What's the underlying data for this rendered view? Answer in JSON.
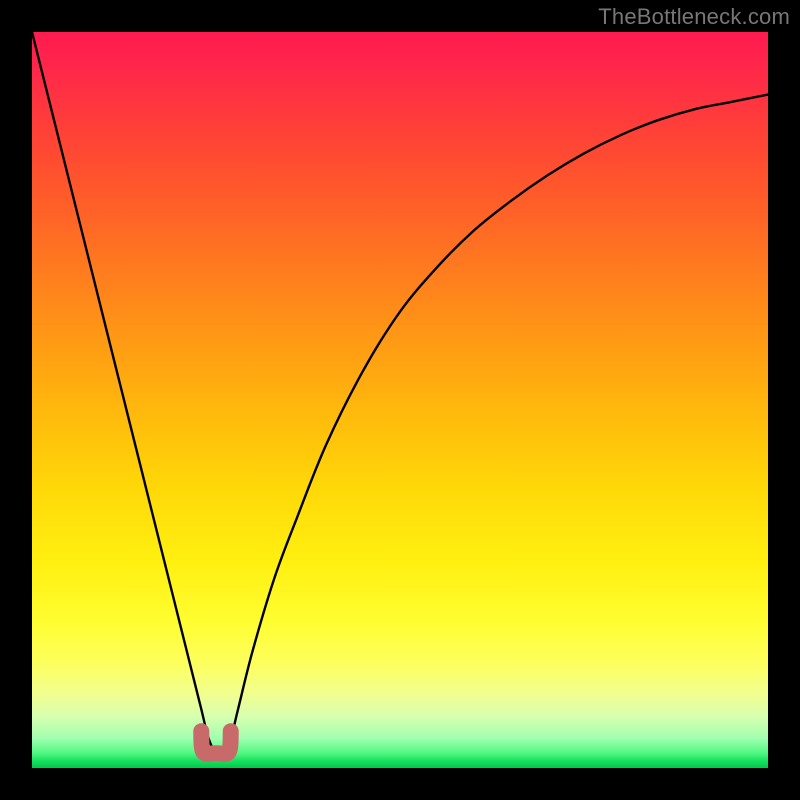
{
  "watermark": "TheBottleneck.com",
  "chart_data": {
    "type": "line",
    "title": "",
    "xlabel": "",
    "ylabel": "",
    "xlim": [
      0,
      100
    ],
    "ylim": [
      0,
      100
    ],
    "grid": false,
    "legend": false,
    "annotations": [],
    "series": [
      {
        "name": "bottleneck-curve",
        "x": [
          0,
          5,
          10,
          15,
          18,
          20,
          22,
          23,
          24,
          25,
          26,
          27,
          28,
          30,
          33,
          36,
          40,
          45,
          50,
          55,
          60,
          65,
          70,
          75,
          80,
          85,
          90,
          95,
          100
        ],
        "y": [
          100,
          80,
          60,
          40,
          28,
          20,
          12,
          8,
          4,
          2,
          2,
          4,
          8,
          16,
          26,
          34,
          44,
          54,
          62,
          68,
          73,
          77,
          80.5,
          83.5,
          86,
          88,
          89.5,
          90.5,
          91.5
        ]
      }
    ],
    "minimum_marker": {
      "x_range": [
        23,
        27
      ],
      "y": 2,
      "color": "#c96a6a"
    },
    "background": {
      "type": "vertical-gradient",
      "stops": [
        {
          "pos": 0,
          "color": "#ff1a50"
        },
        {
          "pos": 50,
          "color": "#ffc400"
        },
        {
          "pos": 80,
          "color": "#ffff40"
        },
        {
          "pos": 100,
          "color": "#00c848"
        }
      ]
    }
  }
}
